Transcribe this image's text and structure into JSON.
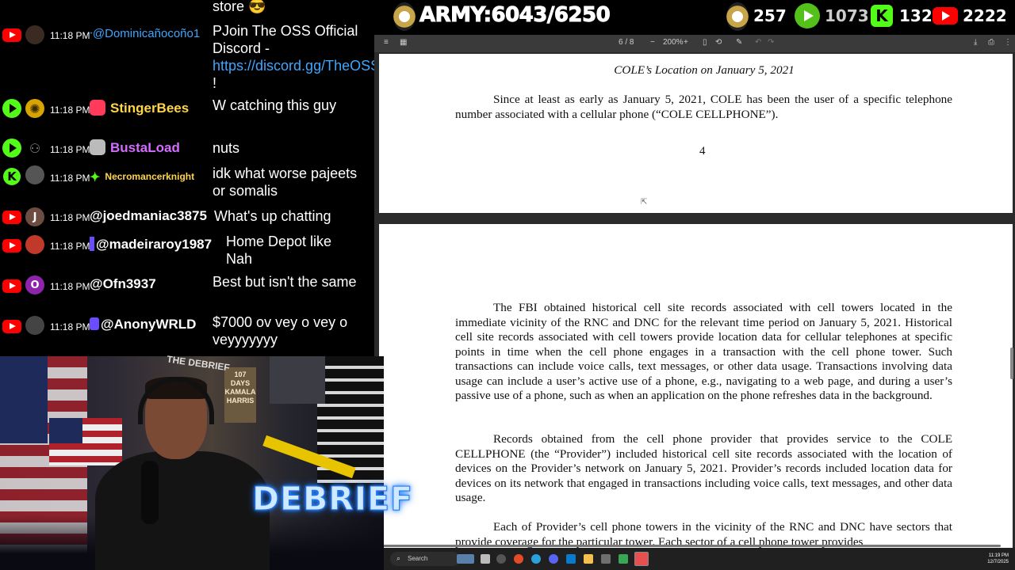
{
  "overlay": {
    "army_label": "ARMY:6043/6250",
    "viewers_partial": "257",
    "rumble_count": "1073",
    "kick_count": "132",
    "youtube_count": "2222"
  },
  "chat": {
    "top_fragment": "store 😎",
    "messages": [
      {
        "platform": "youtube-icon",
        "time": "11:18 PM",
        "user": "@Dominicañocoño1",
        "text_pre": "PJoin The OSS Official Discord - ",
        "link": "https://discord.gg/TheOSS",
        "text_post": " !",
        "user_color": "#3ea6ff"
      },
      {
        "platform": "rumble-icon",
        "time": "11:18 PM",
        "user": "StingerBees",
        "text": "W catching this guy",
        "user_color": "#ffd54a"
      },
      {
        "platform": "rumble-icon",
        "time": "11:18 PM",
        "user": "BustaLoad",
        "text": "nuts",
        "user_color": "#d46cff"
      },
      {
        "platform": "kick-icon",
        "time": "11:18 PM",
        "user": "Necromancerknight",
        "text": "idk what worse pajeets or somalis",
        "user_color": "#ffd54a"
      },
      {
        "platform": "youtube-icon",
        "time": "11:18 PM",
        "user": "@joedmaniac3875",
        "text": "What's up chatting",
        "user_color": "#ffffff",
        "avatar_letter": "J"
      },
      {
        "platform": "youtube-icon",
        "time": "11:18 PM",
        "user": "@madeiraroy1987",
        "text": "Home Depot like Nah",
        "user_color": "#ffffff"
      },
      {
        "platform": "youtube-icon",
        "time": "11:18 PM",
        "user": "@Ofn3937",
        "text": "Best but isn't the same",
        "user_color": "#ffffff",
        "avatar_letter": "O"
      },
      {
        "platform": "youtube-icon",
        "time": "11:18 PM",
        "user": "@AnonyWRLD",
        "text": "$7000 ov vey o vey o veyyyyyyy",
        "user_color": "#ffffff"
      }
    ]
  },
  "viewer": {
    "page_indicator": "6 / 8",
    "zoom": "200%",
    "page1": {
      "heading": "COLE’s Location on January 5, 2021",
      "para": "Since at least as early as January 5, 2021, COLE has been the user of a specific telephone number associated with a cellular phone (“COLE CELLPHONE”).",
      "page_number": "4"
    },
    "page2": {
      "para1": "The FBI obtained historical cell site records associated with cell towers located in the immediate vicinity of the RNC and DNC for the relevant time period on January 5, 2021. Historical cell site records associated with cell towers provide location data for cellular telephones at specific points in time when the cell phone engages in a transaction with the cell phone tower. Such transactions can include voice calls, text messages, or other data usage. Transactions involving data usage can include a user’s active use of a phone, e.g., navigating to a web page, and during a user’s passive use of a phone, such as when an application on the phone refreshes data in the background.",
      "para2": "Records obtained from the cell phone provider that provides service to the COLE CELLPHONE (the “Provider”) included historical cell site records associated with the location of devices on the Provider’s network on January 5, 2021. Provider’s records included location data for devices on its network that engaged in transactions including voice calls, text messages, and other data usage.",
      "para3": "Each of Provider’s cell phone towers in the vicinity of the RNC and DNC have sectors that provide coverage for the particular tower. Each sector of a cell phone tower provides"
    }
  },
  "webcam": {
    "brand_text": "DEBRIEF",
    "poster_text": "107 DAYS KAMALA HARRIS",
    "sign_text": "THE DEBRIEF"
  },
  "taskbar": {
    "search_placeholder": "Search",
    "time": "11:19 PM",
    "date": "12/7/2025"
  }
}
